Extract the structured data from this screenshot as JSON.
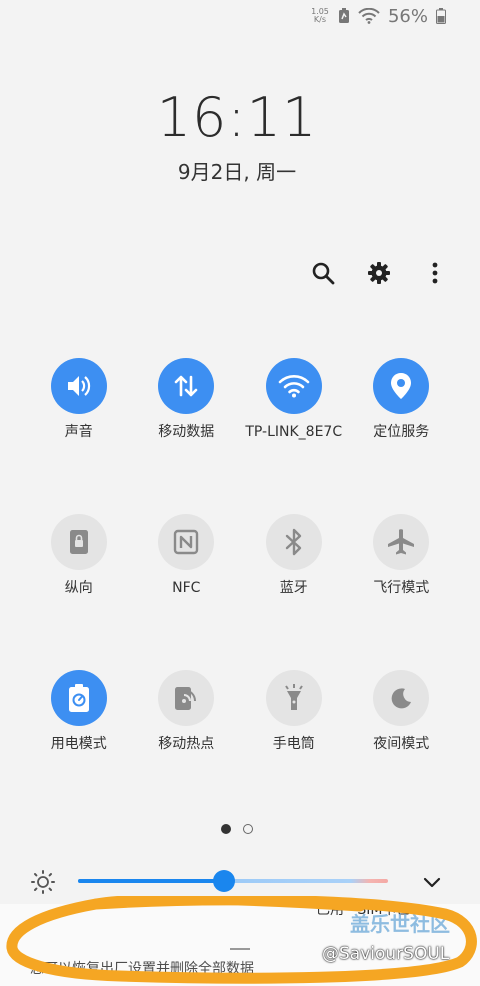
{
  "status_bar": {
    "net_speed_value": "1.05",
    "net_speed_unit": "K/s",
    "battery": "56%"
  },
  "lockscreen": {
    "time": "16:11",
    "date": "9月2日, 周一"
  },
  "header": {
    "icons": [
      "search-icon",
      "gear-icon",
      "more-vertical-icon"
    ]
  },
  "tiles": [
    {
      "label": "声音",
      "on": true,
      "icon": "volume-icon"
    },
    {
      "label": "移动数据",
      "on": true,
      "icon": "mobile-data-icon"
    },
    {
      "label": "TP-LINK_8E7C",
      "on": true,
      "icon": "wifi-icon"
    },
    {
      "label": "定位服务",
      "on": true,
      "icon": "location-icon"
    },
    {
      "label": "纵向",
      "on": false,
      "icon": "portrait-lock-icon"
    },
    {
      "label": "NFC",
      "on": false,
      "icon": "nfc-icon"
    },
    {
      "label": "蓝牙",
      "on": false,
      "icon": "bluetooth-icon"
    },
    {
      "label": "飞行模式",
      "on": false,
      "icon": "airplane-icon"
    },
    {
      "label": "用电模式",
      "on": true,
      "icon": "power-mode-icon"
    },
    {
      "label": "移动热点",
      "on": false,
      "icon": "hotspot-icon"
    },
    {
      "label": "手电筒",
      "on": false,
      "icon": "flashlight-icon"
    },
    {
      "label": "夜间模式",
      "on": false,
      "icon": "night-mode-icon"
    }
  ],
  "pager": {
    "pages": 2,
    "current": 1
  },
  "brightness": {
    "level": 0.47
  },
  "bottom": {
    "peek_text": "已用 · SIM卡已",
    "under_text": "您可以恢复出厂设置并删除全部数据",
    "watermark_title": "盖乐世社区",
    "watermark_handle": "@SaviourSOUL"
  },
  "colors": {
    "accent": "#3d8ff2",
    "tile_off": "#e4e4e4",
    "scribble": "#f5a623"
  }
}
